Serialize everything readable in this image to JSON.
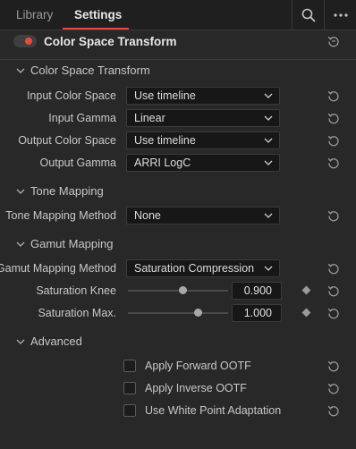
{
  "tabs": [
    {
      "label": "Library",
      "active": false
    },
    {
      "label": "Settings",
      "active": true
    }
  ],
  "toolbar_icons": [
    "search-icon",
    "more-icon"
  ],
  "accent_color": "#e64b3c",
  "header": {
    "title": "Color Space Transform",
    "enabled": true
  },
  "sections": {
    "cst": "Color Space Transform",
    "tone": "Tone Mapping",
    "gamut": "Gamut Mapping",
    "advanced": "Advanced"
  },
  "cst": {
    "input_color_space": {
      "label": "Input Color Space",
      "value": "Use timeline"
    },
    "input_gamma": {
      "label": "Input Gamma",
      "value": "Linear"
    },
    "output_color_space": {
      "label": "Output Color Space",
      "value": "Use timeline"
    },
    "output_gamma": {
      "label": "Output Gamma",
      "value": "ARRI LogC"
    }
  },
  "tone": {
    "method": {
      "label": "Tone Mapping Method",
      "value": "None"
    }
  },
  "gamut": {
    "method": {
      "label": "Gamut Mapping Method",
      "value": "Saturation Compression"
    },
    "knee": {
      "label": "Saturation Knee",
      "value": "0.900",
      "level": 0.55
    },
    "max": {
      "label": "Saturation Max.",
      "value": "1.000",
      "level": 0.7
    }
  },
  "advanced": {
    "forward_ootf": {
      "label": "Apply Forward OOTF",
      "checked": false
    },
    "inverse_ootf": {
      "label": "Apply Inverse OOTF",
      "checked": false
    },
    "white_point": {
      "label": "Use White Point Adaptation",
      "checked": false
    }
  }
}
